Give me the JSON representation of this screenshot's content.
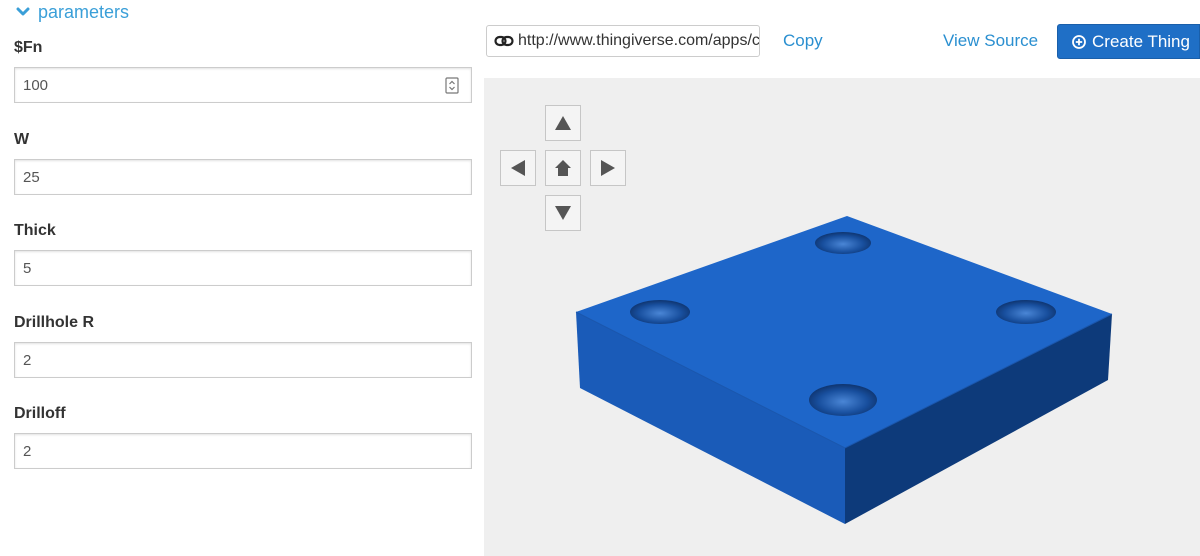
{
  "parameters": {
    "section_title": "parameters",
    "fields": [
      {
        "label": "$Fn",
        "value": "100"
      },
      {
        "label": "W",
        "value": "25"
      },
      {
        "label": "Thick",
        "value": "5"
      },
      {
        "label": "Drillhole R",
        "value": "2"
      },
      {
        "label": "Drilloff",
        "value": "2"
      }
    ]
  },
  "toolbar": {
    "url": "http://www.thingiverse.com/apps/customizer/run",
    "copy_label": "Copy",
    "view_source_label": "View Source",
    "create_label": "Create Thing"
  },
  "viewer": {
    "model_color": "#1f63c4",
    "background_color": "#efefef",
    "nav_buttons": [
      "up",
      "left",
      "home",
      "right",
      "down"
    ]
  },
  "colors": {
    "accent": "#2a8fd0",
    "primary_button": "#1f6fc6"
  },
  "icons": {
    "section_toggle": "chevron-down-icon",
    "url": "link-icon",
    "create": "plus-circle-icon",
    "field": "stepper-icon"
  }
}
